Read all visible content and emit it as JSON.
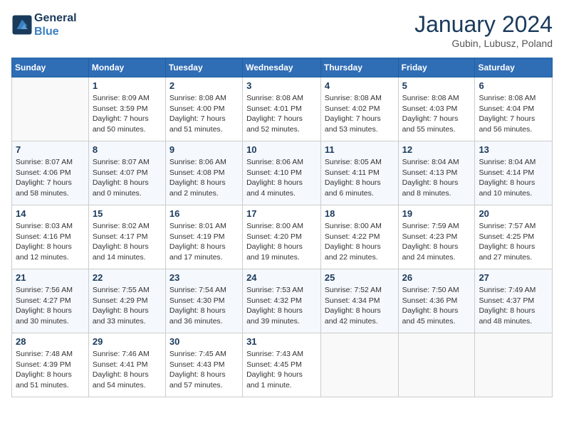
{
  "header": {
    "logo_line1": "General",
    "logo_line2": "Blue",
    "title": "January 2024",
    "location": "Gubin, Lubusz, Poland"
  },
  "weekdays": [
    "Sunday",
    "Monday",
    "Tuesday",
    "Wednesday",
    "Thursday",
    "Friday",
    "Saturday"
  ],
  "weeks": [
    [
      {
        "day": "",
        "sunrise": "",
        "sunset": "",
        "daylight": ""
      },
      {
        "day": "1",
        "sunrise": "Sunrise: 8:09 AM",
        "sunset": "Sunset: 3:59 PM",
        "daylight": "Daylight: 7 hours and 50 minutes."
      },
      {
        "day": "2",
        "sunrise": "Sunrise: 8:08 AM",
        "sunset": "Sunset: 4:00 PM",
        "daylight": "Daylight: 7 hours and 51 minutes."
      },
      {
        "day": "3",
        "sunrise": "Sunrise: 8:08 AM",
        "sunset": "Sunset: 4:01 PM",
        "daylight": "Daylight: 7 hours and 52 minutes."
      },
      {
        "day": "4",
        "sunrise": "Sunrise: 8:08 AM",
        "sunset": "Sunset: 4:02 PM",
        "daylight": "Daylight: 7 hours and 53 minutes."
      },
      {
        "day": "5",
        "sunrise": "Sunrise: 8:08 AM",
        "sunset": "Sunset: 4:03 PM",
        "daylight": "Daylight: 7 hours and 55 minutes."
      },
      {
        "day": "6",
        "sunrise": "Sunrise: 8:08 AM",
        "sunset": "Sunset: 4:04 PM",
        "daylight": "Daylight: 7 hours and 56 minutes."
      }
    ],
    [
      {
        "day": "7",
        "sunrise": "Sunrise: 8:07 AM",
        "sunset": "Sunset: 4:06 PM",
        "daylight": "Daylight: 7 hours and 58 minutes."
      },
      {
        "day": "8",
        "sunrise": "Sunrise: 8:07 AM",
        "sunset": "Sunset: 4:07 PM",
        "daylight": "Daylight: 8 hours and 0 minutes."
      },
      {
        "day": "9",
        "sunrise": "Sunrise: 8:06 AM",
        "sunset": "Sunset: 4:08 PM",
        "daylight": "Daylight: 8 hours and 2 minutes."
      },
      {
        "day": "10",
        "sunrise": "Sunrise: 8:06 AM",
        "sunset": "Sunset: 4:10 PM",
        "daylight": "Daylight: 8 hours and 4 minutes."
      },
      {
        "day": "11",
        "sunrise": "Sunrise: 8:05 AM",
        "sunset": "Sunset: 4:11 PM",
        "daylight": "Daylight: 8 hours and 6 minutes."
      },
      {
        "day": "12",
        "sunrise": "Sunrise: 8:04 AM",
        "sunset": "Sunset: 4:13 PM",
        "daylight": "Daylight: 8 hours and 8 minutes."
      },
      {
        "day": "13",
        "sunrise": "Sunrise: 8:04 AM",
        "sunset": "Sunset: 4:14 PM",
        "daylight": "Daylight: 8 hours and 10 minutes."
      }
    ],
    [
      {
        "day": "14",
        "sunrise": "Sunrise: 8:03 AM",
        "sunset": "Sunset: 4:16 PM",
        "daylight": "Daylight: 8 hours and 12 minutes."
      },
      {
        "day": "15",
        "sunrise": "Sunrise: 8:02 AM",
        "sunset": "Sunset: 4:17 PM",
        "daylight": "Daylight: 8 hours and 14 minutes."
      },
      {
        "day": "16",
        "sunrise": "Sunrise: 8:01 AM",
        "sunset": "Sunset: 4:19 PM",
        "daylight": "Daylight: 8 hours and 17 minutes."
      },
      {
        "day": "17",
        "sunrise": "Sunrise: 8:00 AM",
        "sunset": "Sunset: 4:20 PM",
        "daylight": "Daylight: 8 hours and 19 minutes."
      },
      {
        "day": "18",
        "sunrise": "Sunrise: 8:00 AM",
        "sunset": "Sunset: 4:22 PM",
        "daylight": "Daylight: 8 hours and 22 minutes."
      },
      {
        "day": "19",
        "sunrise": "Sunrise: 7:59 AM",
        "sunset": "Sunset: 4:23 PM",
        "daylight": "Daylight: 8 hours and 24 minutes."
      },
      {
        "day": "20",
        "sunrise": "Sunrise: 7:57 AM",
        "sunset": "Sunset: 4:25 PM",
        "daylight": "Daylight: 8 hours and 27 minutes."
      }
    ],
    [
      {
        "day": "21",
        "sunrise": "Sunrise: 7:56 AM",
        "sunset": "Sunset: 4:27 PM",
        "daylight": "Daylight: 8 hours and 30 minutes."
      },
      {
        "day": "22",
        "sunrise": "Sunrise: 7:55 AM",
        "sunset": "Sunset: 4:29 PM",
        "daylight": "Daylight: 8 hours and 33 minutes."
      },
      {
        "day": "23",
        "sunrise": "Sunrise: 7:54 AM",
        "sunset": "Sunset: 4:30 PM",
        "daylight": "Daylight: 8 hours and 36 minutes."
      },
      {
        "day": "24",
        "sunrise": "Sunrise: 7:53 AM",
        "sunset": "Sunset: 4:32 PM",
        "daylight": "Daylight: 8 hours and 39 minutes."
      },
      {
        "day": "25",
        "sunrise": "Sunrise: 7:52 AM",
        "sunset": "Sunset: 4:34 PM",
        "daylight": "Daylight: 8 hours and 42 minutes."
      },
      {
        "day": "26",
        "sunrise": "Sunrise: 7:50 AM",
        "sunset": "Sunset: 4:36 PM",
        "daylight": "Daylight: 8 hours and 45 minutes."
      },
      {
        "day": "27",
        "sunrise": "Sunrise: 7:49 AM",
        "sunset": "Sunset: 4:37 PM",
        "daylight": "Daylight: 8 hours and 48 minutes."
      }
    ],
    [
      {
        "day": "28",
        "sunrise": "Sunrise: 7:48 AM",
        "sunset": "Sunset: 4:39 PM",
        "daylight": "Daylight: 8 hours and 51 minutes."
      },
      {
        "day": "29",
        "sunrise": "Sunrise: 7:46 AM",
        "sunset": "Sunset: 4:41 PM",
        "daylight": "Daylight: 8 hours and 54 minutes."
      },
      {
        "day": "30",
        "sunrise": "Sunrise: 7:45 AM",
        "sunset": "Sunset: 4:43 PM",
        "daylight": "Daylight: 8 hours and 57 minutes."
      },
      {
        "day": "31",
        "sunrise": "Sunrise: 7:43 AM",
        "sunset": "Sunset: 4:45 PM",
        "daylight": "Daylight: 9 hours and 1 minute."
      },
      {
        "day": "",
        "sunrise": "",
        "sunset": "",
        "daylight": ""
      },
      {
        "day": "",
        "sunrise": "",
        "sunset": "",
        "daylight": ""
      },
      {
        "day": "",
        "sunrise": "",
        "sunset": "",
        "daylight": ""
      }
    ]
  ]
}
